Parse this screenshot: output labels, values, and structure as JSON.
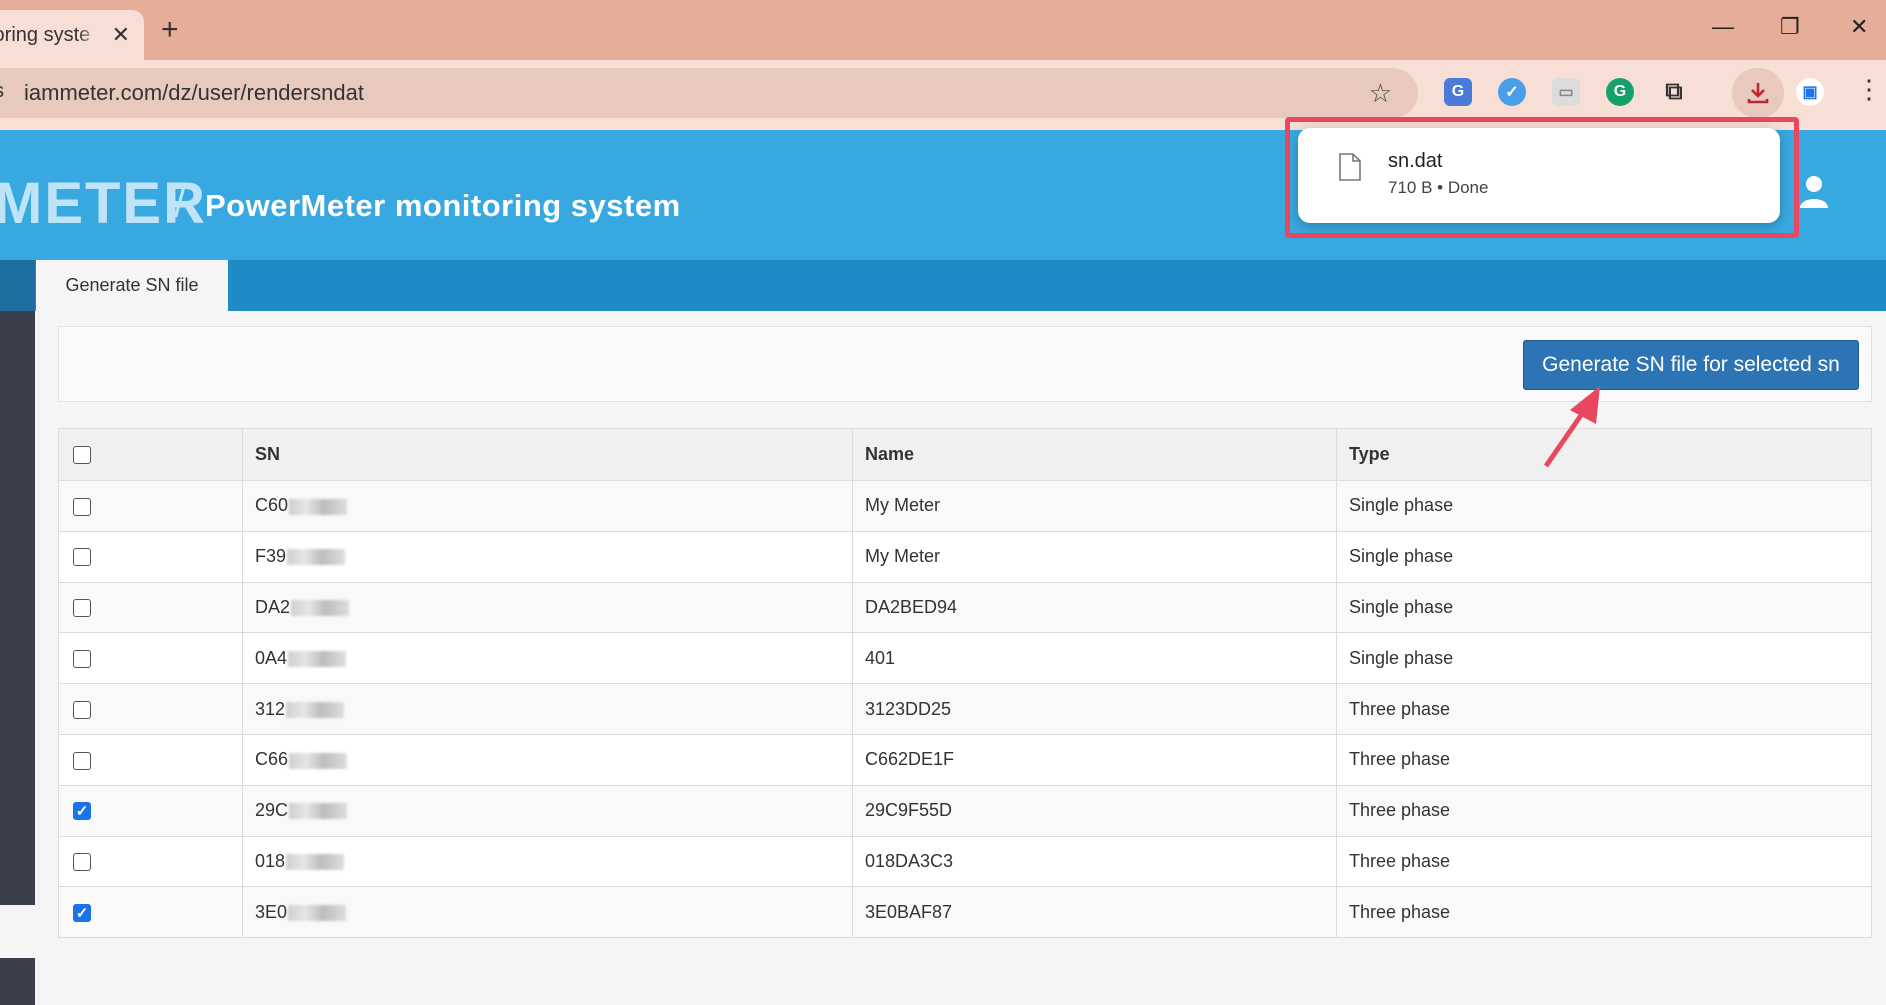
{
  "browser": {
    "tab_title": "toring syste",
    "new_tab": "+",
    "tab_close": "✕",
    "url_lead": "s",
    "url": "iammeter.com/dz/user/rendersndat",
    "window_controls": {
      "minimize": "—",
      "maximize": "❐",
      "close": "✕"
    }
  },
  "download": {
    "file_name": "sn.dat",
    "file_meta": "710 B • Done"
  },
  "header": {
    "logo": "METER",
    "separator": "/",
    "title": "PowerMeter monitoring system"
  },
  "tabs": {
    "active": "Generate SN file"
  },
  "panel": {
    "generate_button": "Generate SN file for selected sn"
  },
  "table": {
    "columns": [
      "SN",
      "Name",
      "Type"
    ],
    "rows": [
      {
        "sn": "C60",
        "name": "My Meter",
        "type": "Single phase",
        "checked": false
      },
      {
        "sn": "F39",
        "name": "My Meter",
        "type": "Single phase",
        "checked": false
      },
      {
        "sn": "DA2",
        "name": "DA2BED94",
        "type": "Single phase",
        "checked": false
      },
      {
        "sn": "0A4",
        "name": "401",
        "type": "Single phase",
        "checked": false
      },
      {
        "sn": "312",
        "name": "3123DD25",
        "type": "Three phase",
        "checked": false
      },
      {
        "sn": "C66",
        "name": "C662DE1F",
        "type": "Three phase",
        "checked": false
      },
      {
        "sn": "29C",
        "name": "29C9F55D",
        "type": "Three phase",
        "checked": true
      },
      {
        "sn": "018",
        "name": "018DA3C3",
        "type": "Three phase",
        "checked": false
      },
      {
        "sn": "3E0",
        "name": "3E0BAF87",
        "type": "Three phase",
        "checked": true
      }
    ]
  },
  "colors": {
    "header_blue": "#38a9e0",
    "tabbar_blue": "#1e8bc6",
    "button_blue": "#2d74b5",
    "highlight_red": "#e8475f"
  }
}
